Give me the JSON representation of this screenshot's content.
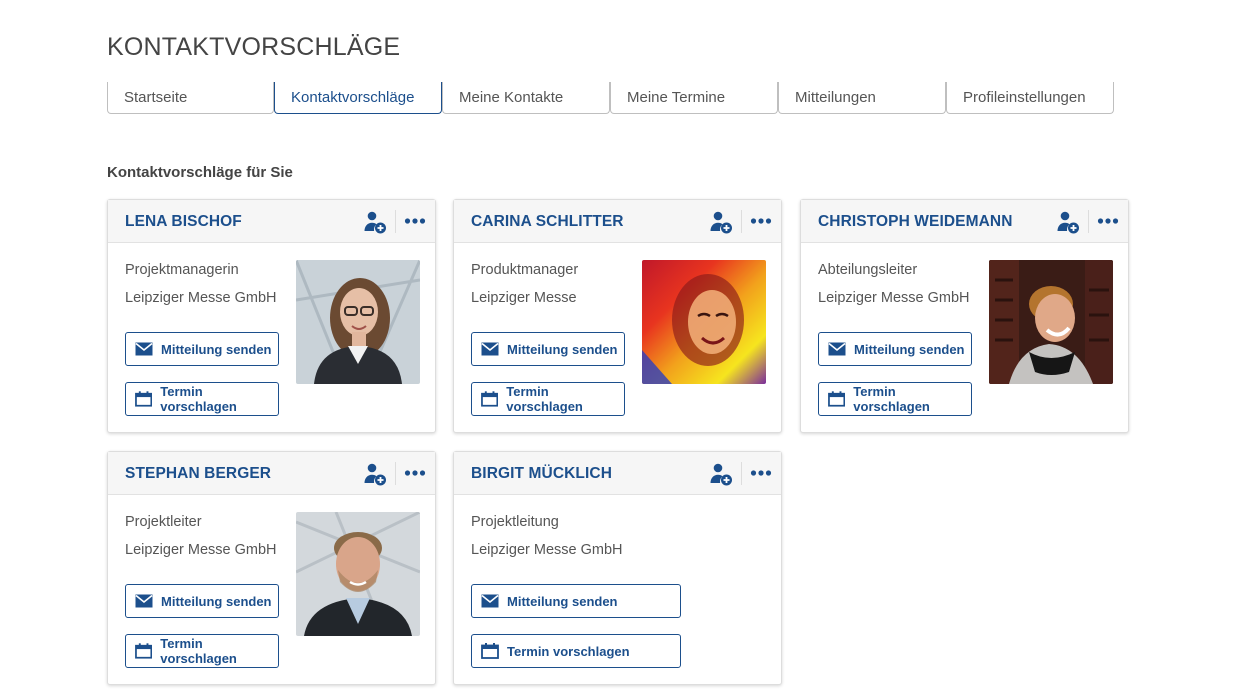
{
  "page": {
    "title": "KONTAKTVORSCHLÄGE",
    "section_title": "Kontaktvorschläge für Sie"
  },
  "tabs": [
    {
      "label": "Startseite",
      "active": false
    },
    {
      "label": "Kontaktvorschläge",
      "active": true
    },
    {
      "label": "Meine Kontakte",
      "active": false
    },
    {
      "label": "Meine Termine",
      "active": false
    },
    {
      "label": "Mitteilungen",
      "active": false
    },
    {
      "label": "Profileinstellungen",
      "active": false
    }
  ],
  "buttons": {
    "message": "Mitteilung senden",
    "appointment": "Termin vorschlagen"
  },
  "icons": {
    "add_contact": "add-contact-icon",
    "more": "more-options-icon",
    "message": "envelope-icon",
    "appointment": "calendar-icon"
  },
  "contacts": [
    {
      "name": "LENA BISCHOF",
      "role": "Projektmanagerin",
      "company": "Leipziger Messe GmbH",
      "has_photo": true
    },
    {
      "name": "CARINA SCHLITTER",
      "role": "Produktmanager",
      "company": "Leipziger Messe",
      "has_photo": true
    },
    {
      "name": "CHRISTOPH WEIDEMANN",
      "role": "Abteilungsleiter",
      "company": "Leipziger Messe GmbH",
      "has_photo": true
    },
    {
      "name": "STEPHAN BERGER",
      "role": "Projektleiter",
      "company": "Leipziger Messe GmbH",
      "has_photo": true
    },
    {
      "name": "BIRGIT MÜCKLICH",
      "role": "Projektleitung",
      "company": "Leipziger Messe GmbH",
      "has_photo": false
    }
  ],
  "colors": {
    "accent": "#1c4f8c",
    "text": "#555555",
    "header_bg": "#f6f6f6",
    "border": "#dddddd"
  }
}
